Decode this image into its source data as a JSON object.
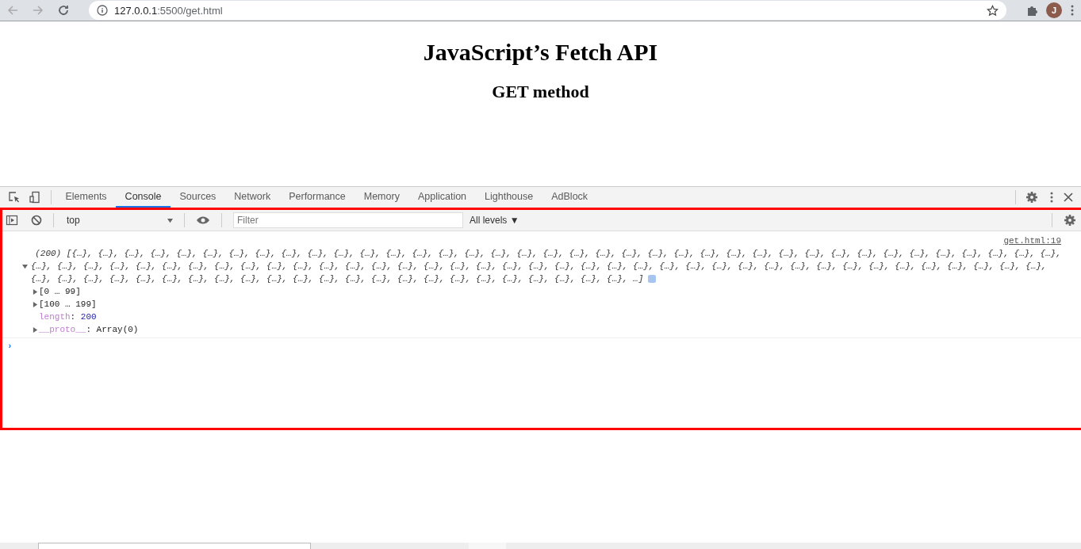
{
  "browser": {
    "url_host": "127.0.0.1",
    "url_rest": ":5500/get.html",
    "avatar_letter": "J"
  },
  "page": {
    "title": "JavaScript’s Fetch API",
    "subtitle": "GET method"
  },
  "devtools": {
    "tabs": [
      {
        "label": "Elements",
        "selected": false
      },
      {
        "label": "Console",
        "selected": true
      },
      {
        "label": "Sources",
        "selected": false
      },
      {
        "label": "Network",
        "selected": false
      },
      {
        "label": "Performance",
        "selected": false
      },
      {
        "label": "Memory",
        "selected": false
      },
      {
        "label": "Application",
        "selected": false
      },
      {
        "label": "Lighthouse",
        "selected": false
      },
      {
        "label": "AdBlock",
        "selected": false
      }
    ],
    "console": {
      "context": "top",
      "filter_placeholder": "Filter",
      "levels": "All levels ▼",
      "highlighted": true,
      "source_link": "get.html:19",
      "preview_lines": [
        "(200) [{…}, {…}, {…}, {…}, {…}, {…}, {…}, {…}, {…}, {…}, {…}, {…}, {…}, {…}, {…}, {…}, {…}, {…}, {…}, {…}, {…}, {…}, {…}, {…}, {…}, {…}, {…}, {…}, {…}, {…}, {…}, {…}, {…}, {…}, {…}, {…}, {…}, {…},",
        "{…}, {…}, {…}, {…}, {…}, {…}, {…}, {…}, {…}, {…}, {…}, {…}, {…}, {…}, {…}, {…}, {…}, {…}, {…}, {…}, {…}, {…}, {…}, {…}, {…}, {…}, {…}, {…}, {…}, {…}, {…}, {…}, {…}, {…}, {…}, {…}, {…}, {…}, {…},",
        "{…}, {…}, {…}, {…}, {…}, {…}, {…}, {…}, {…}, {…}, {…}, {…}, {…}, {…}, {…}, {…}, {…}, {…}, {…}, {…}, {…}, {…}, {…}, …]"
      ],
      "expanded": true,
      "entries": [
        {
          "kind": "group",
          "label": "[0 … 99]",
          "expanded": false
        },
        {
          "kind": "group",
          "label": "[100 … 199]",
          "expanded": false
        },
        {
          "kind": "property",
          "key": "length",
          "separator": ":",
          "value": "200"
        },
        {
          "kind": "group",
          "label": "__proto__",
          "value": ": Array(0)",
          "expanded": false
        }
      ],
      "prompt": "›"
    }
  }
}
